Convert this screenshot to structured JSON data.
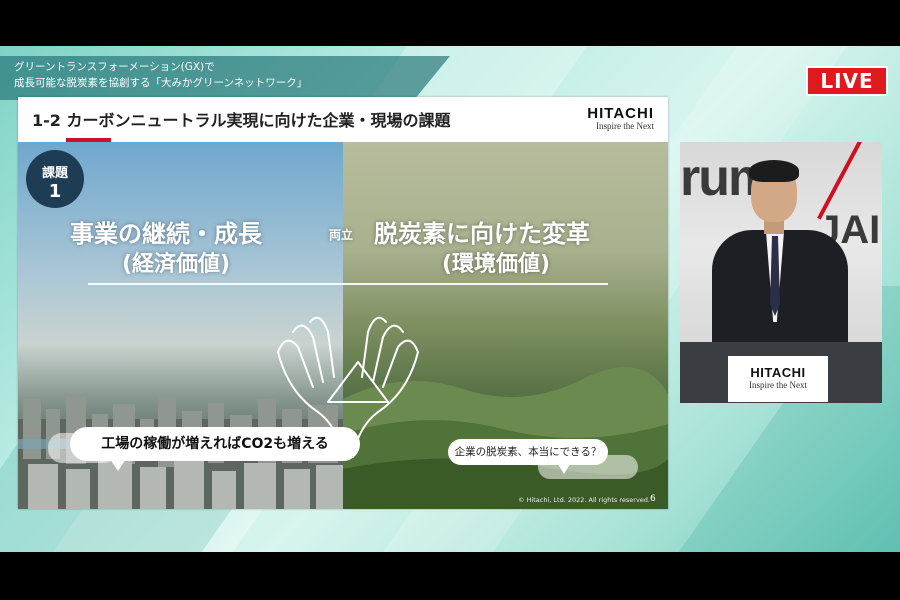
{
  "broadcast": {
    "topic_line1": "グリーントランスフォーメーション(GX)で",
    "topic_line2": "成長可能な脱炭素を協創する「大みかグリーンネットワーク」",
    "live_label": "LIVE"
  },
  "slide": {
    "title": "1-2 カーボンニュートラル実現に向けた企業・現場の課題",
    "logo_name": "HITACHI",
    "logo_tagline": "Inspire the Next",
    "badge_line1": "課題",
    "badge_line2": "1",
    "left_heading": "事業の継続・成長",
    "left_subheading": "(経済価値)",
    "middle_label": "両立",
    "right_heading": "脱炭素に向けた変革",
    "right_subheading": "(環境価値)",
    "bubble_left": "工場の稼働が増えればCO2も増える",
    "bubble_right": "企業の脱炭素、本当にできる？",
    "copyright": "© Hitachi, Ltd. 2022. All rights reserved.",
    "page_number": "6"
  },
  "speaker_panel": {
    "backdrop_text": "rum",
    "backdrop_text2": "JAI",
    "podium_logo_name": "HITACHI",
    "podium_logo_tagline": "Inspire the Next"
  },
  "colors": {
    "live_red": "#e0191e",
    "hitachi_red": "#d00f1f",
    "badge_navy": "#1e3d55",
    "background_teal": "#7fd3c6"
  }
}
